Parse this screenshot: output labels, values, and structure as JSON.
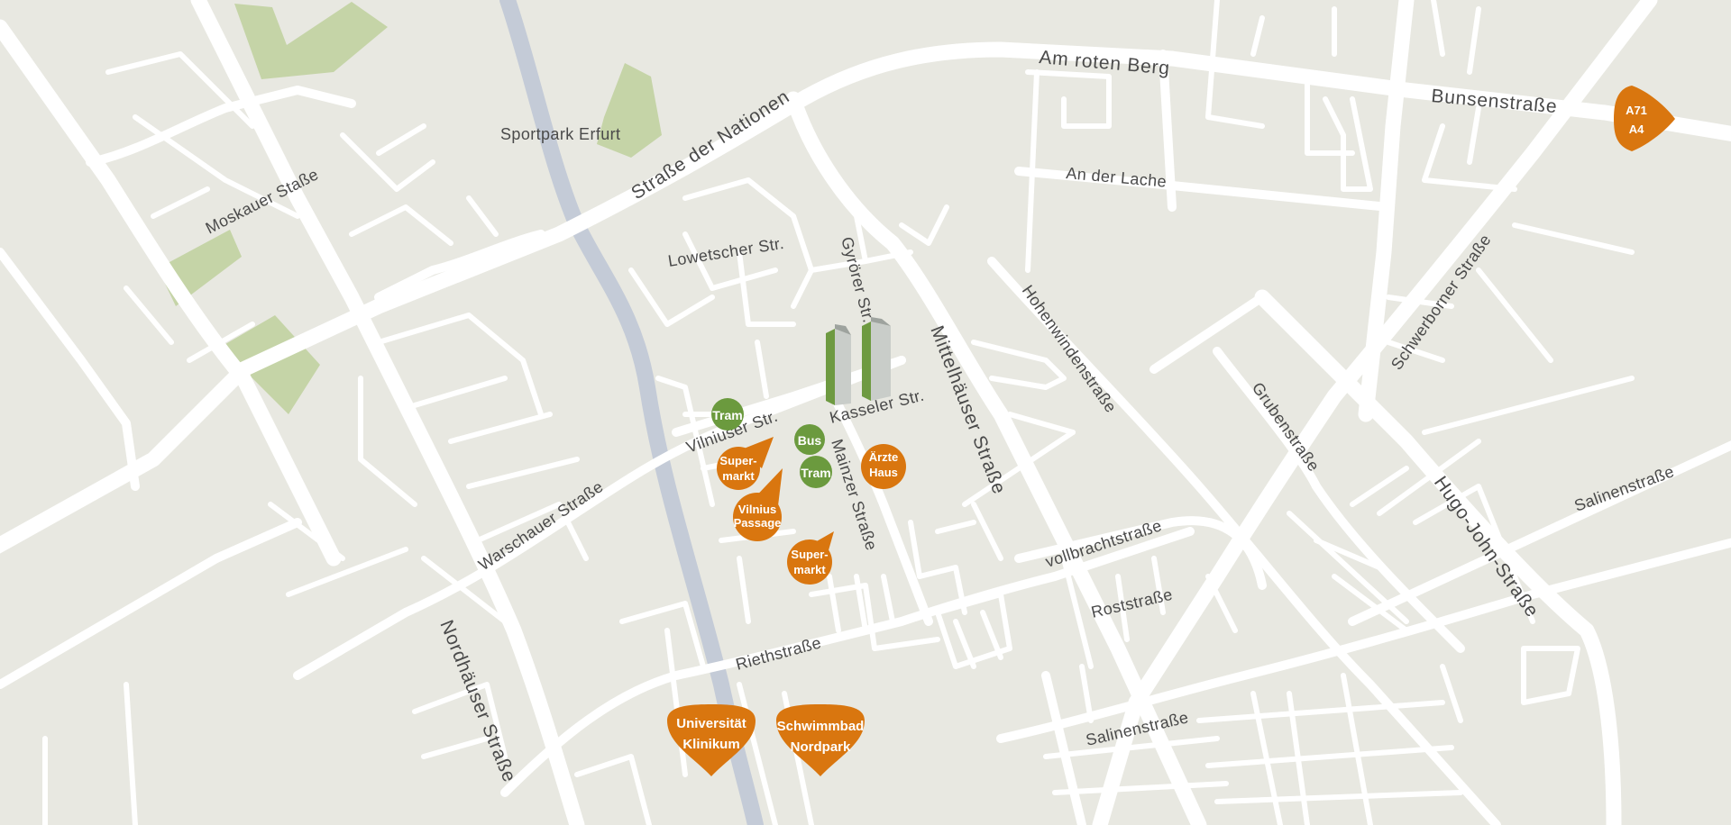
{
  "map": {
    "colors": {
      "background": "#e8e8e1",
      "road": "#ffffff",
      "river": "#c4cbd7",
      "park": "#c5d4a7",
      "poi_green": "#6b9a3e",
      "poi_orange": "#d9760f",
      "building_green": "#6e9a41",
      "building_grey": "#c9cdc9"
    },
    "streets": {
      "am_roten_berg": "Am roten Berg",
      "bunsenstrasse": "Bunsenstraße",
      "an_der_lache": "An der Lache",
      "strasse_der_nationen": "Straße der Nationen",
      "moskauer": "Moskauer Staße",
      "lowetscher": "Lowetscher Str.",
      "gyoerer": "Gyrörer Str.",
      "mittelhaeuser": "Mittelhäuser Straße",
      "hohenwinden": "Hohenwindenstraße",
      "schwerborner": "Schwerborner Straße",
      "kasseler": "Kasseler Str.",
      "vilniuser": "Vilniuser Str.",
      "mainzer": "Mainzer Straße",
      "grubenstrasse": "Grubenstraße",
      "hugo_john": "Hugo-John-Straße",
      "salinenstrasse_east": "Salinenstraße",
      "warschauer": "Warschauer Straße",
      "vollbrachtstrasse": "vollbrachtstraße",
      "roststrasse": "Roststraße",
      "riethstrasse": "Riethstraße",
      "salinenstrasse_south": "Salinenstraße",
      "nordhaeuser": "Nordhäuser Straße"
    },
    "places": {
      "sportpark": "Sportpark Erfurt"
    },
    "poi": {
      "tram_1": "Tram",
      "bus": "Bus",
      "tram_2": "Tram",
      "supermarkt_1": [
        "Super-",
        "markt"
      ],
      "vilnius_passage": [
        "Vilnius",
        "Passage"
      ],
      "supermarkt_2": [
        "Super-",
        "markt"
      ],
      "aerztehaus": [
        "Ärzte",
        "Haus"
      ],
      "uniklinikum": [
        "Universität",
        "Klinikum"
      ],
      "schwimmbad": [
        "Schwimmbad",
        "Nordpark"
      ],
      "autobahn": [
        "A71",
        "A4"
      ]
    }
  }
}
